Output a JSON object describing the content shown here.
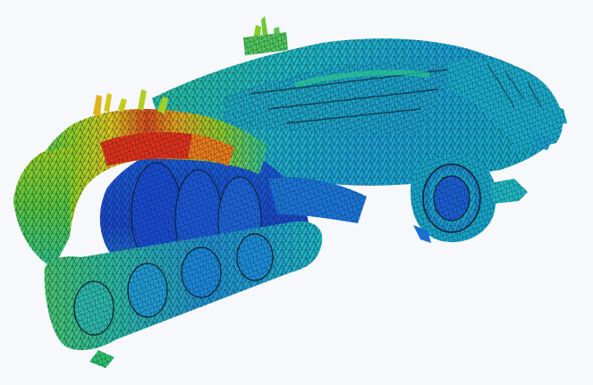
{
  "scene": {
    "subject": "intake-manifold",
    "render_style": "fea-triangular-mesh-contour",
    "background_color": "#f7f8fc",
    "mesh_line_color": "#0a1f2a",
    "colormap": [
      "#1c3fd0",
      "#1e7fe0",
      "#19b8c8",
      "#22c08a",
      "#7ccf2a",
      "#d6d21a",
      "#f08a18",
      "#e0301a"
    ],
    "hotspot_color": "#e0301a"
  }
}
